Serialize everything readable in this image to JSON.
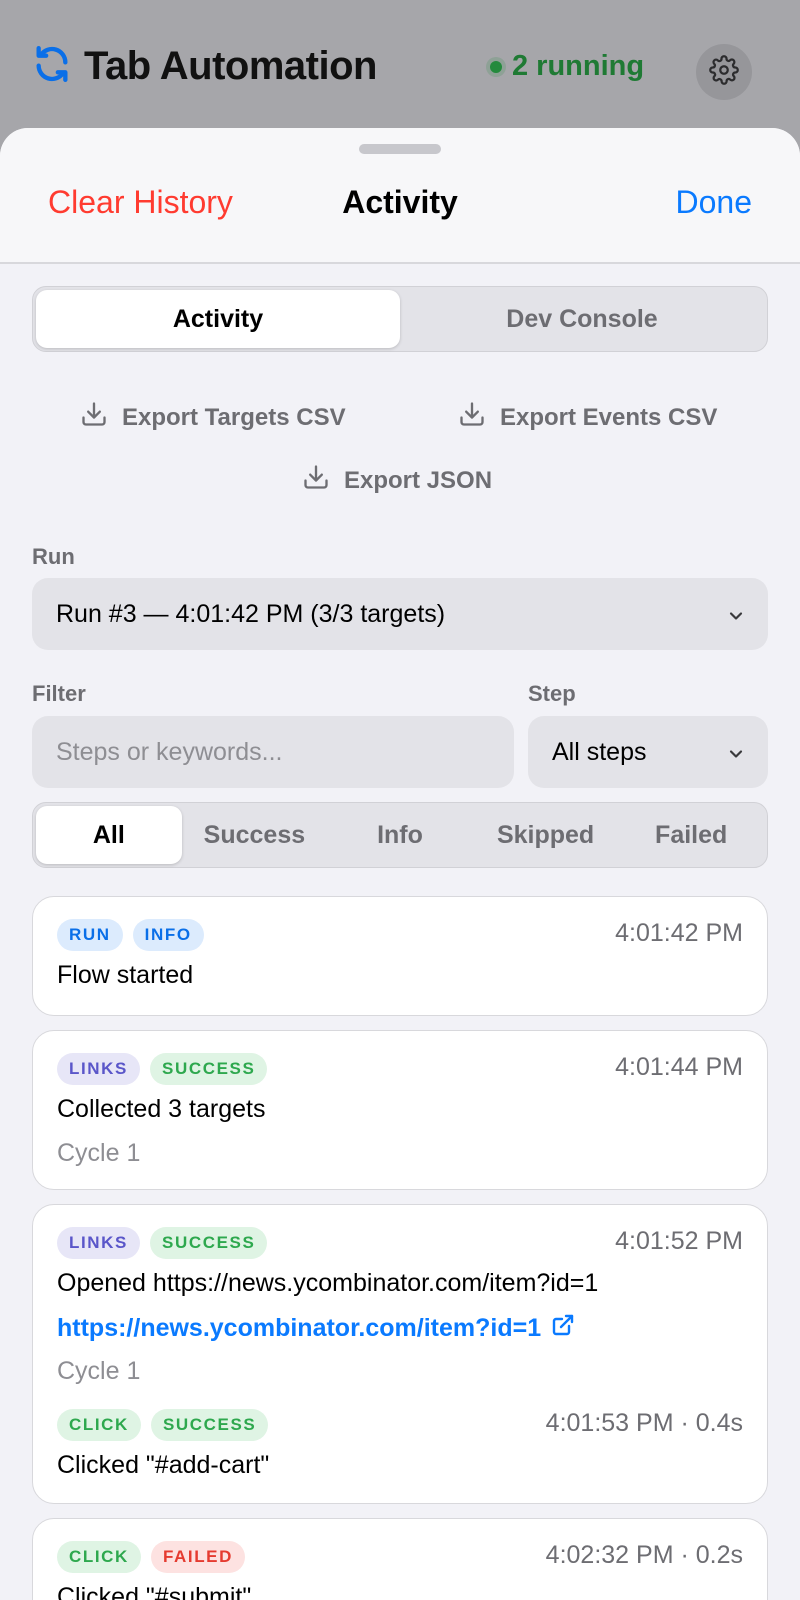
{
  "app": {
    "title": "Tab Automation",
    "status": "2 running",
    "icons": {
      "app": "refresh-icon",
      "settings": "gear-icon"
    }
  },
  "sheet": {
    "nav": {
      "left": "Clear History",
      "title": "Activity",
      "right": "Done"
    },
    "tabs": [
      {
        "label": "Activity",
        "active": true
      },
      {
        "label": "Dev Console",
        "active": false
      }
    ],
    "exports": {
      "targets_csv": "Export Targets CSV",
      "events_csv": "Export Events CSV",
      "json": "Export JSON"
    },
    "run": {
      "label": "Run",
      "value": "Run #3 — 4:01:42 PM (3/3 targets)"
    },
    "filter": {
      "label": "Filter",
      "placeholder": "Steps or keywords..."
    },
    "step": {
      "label": "Step",
      "value": "All steps"
    },
    "status_filters": [
      {
        "label": "All",
        "active": true
      },
      {
        "label": "Success",
        "active": false
      },
      {
        "label": "Info",
        "active": false
      },
      {
        "label": "Skipped",
        "active": false
      },
      {
        "label": "Failed",
        "active": false
      }
    ],
    "events": [
      {
        "tags": [
          "RUN",
          "INFO"
        ],
        "time": "4:01:42 PM",
        "message": "Flow started"
      },
      {
        "tags": [
          "LINKS",
          "SUCCESS"
        ],
        "time": "4:01:44 PM",
        "message": "Collected 3 targets",
        "sub": "Cycle 1"
      },
      {
        "tags": [
          "LINKS",
          "SUCCESS"
        ],
        "time": "4:01:52 PM",
        "message": "Opened https://news.ycombinator.com/item?id=1",
        "link": "https://news.ycombinator.com/item?id=1",
        "sub": "Cycle 1",
        "child": {
          "tags": [
            "CLICK",
            "SUCCESS"
          ],
          "time": "4:01:53 PM · 0.4s",
          "message": "Clicked \"#add-cart\""
        }
      },
      {
        "tags": [
          "CLICK",
          "FAILED"
        ],
        "time": "4:02:32 PM · 0.2s",
        "message": "Clicked \"#submit\""
      }
    ]
  },
  "colors": {
    "accent": "#0a7aff",
    "destructive": "#ff3b30",
    "running": "#248a3d"
  }
}
